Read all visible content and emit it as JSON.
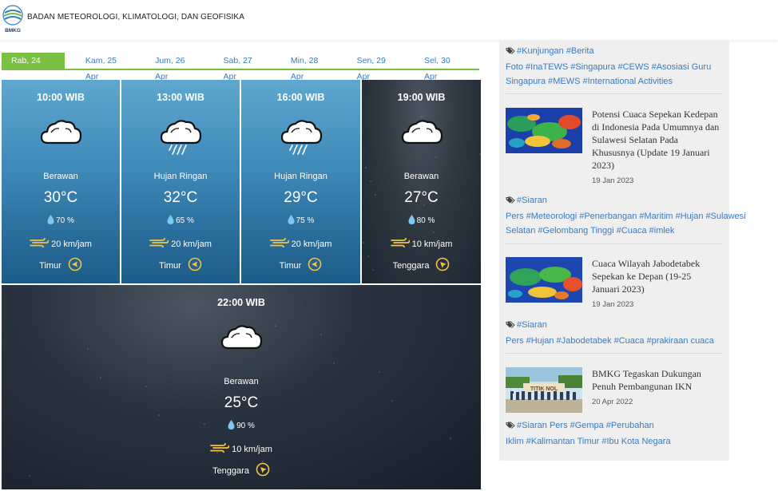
{
  "header": {
    "org_name": "BADAN METEOROLOGI, KLIMATOLOGI, DAN GEOFISIKA",
    "logo_text": "BMKG"
  },
  "tabs": [
    {
      "label": "Rab, 24 Apr",
      "active": true
    },
    {
      "label": "Kam, 25 Apr",
      "active": false
    },
    {
      "label": "Jum, 26 Apr",
      "active": false
    },
    {
      "label": "Sab, 27 Apr",
      "active": false
    },
    {
      "label": "Min, 28 Apr",
      "active": false
    },
    {
      "label": "Sen, 29 Apr",
      "active": false
    },
    {
      "label": "Sel, 30 Apr",
      "active": false
    }
  ],
  "forecasts": [
    {
      "time": "10:00 WIB",
      "icon": "cloudy-icon",
      "desc": "Berawan",
      "temp": "30°C",
      "humidity": "70 %",
      "wind": "20 km/jam",
      "direction": "Timur",
      "theme": "day"
    },
    {
      "time": "13:00 WIB",
      "icon": "light-rain-icon",
      "desc": "Hujan Ringan",
      "temp": "32°C",
      "humidity": "65 %",
      "wind": "20 km/jam",
      "direction": "Timur",
      "theme": "day"
    },
    {
      "time": "16:00 WIB",
      "icon": "light-rain-icon",
      "desc": "Hujan Ringan",
      "temp": "29°C",
      "humidity": "75 %",
      "wind": "20 km/jam",
      "direction": "Timur",
      "theme": "day"
    },
    {
      "time": "19:00 WIB",
      "icon": "cloudy-icon",
      "desc": "Berawan",
      "temp": "27°C",
      "humidity": "80 %",
      "wind": "10 km/jam",
      "direction": "Tenggara",
      "theme": "night"
    },
    {
      "time": "22:00 WIB",
      "icon": "cloudy-icon",
      "desc": "Berawan",
      "temp": "25°C",
      "humidity": "90 %",
      "wind": "10 km/jam",
      "direction": "Tenggara",
      "theme": "night"
    }
  ],
  "sidebar": {
    "top_tags": [
      "#Kunjungan",
      "#Berita Foto",
      "#InaTEWS",
      "#Singapura",
      "#CEWS",
      "#Asosiasi Guru Singapura",
      "#MEWS",
      "#International Activities"
    ],
    "news": [
      {
        "title": "Potensi Cuaca Sepekan Kedepan di Indonesia Pada Umumnya dan Sulawesi Selatan Pada Khususnya (Update 19 Januari 2023)",
        "date": "19 Jan 2023",
        "image": "weather-map-thumbnail",
        "tags": [
          "#Siaran Pers",
          "#Meteorologi",
          "#Penerbangan",
          "#Maritim",
          "#Hujan",
          "#Sulawesi Selatan",
          "#Gelombang Tinggi",
          "#Cuaca",
          "#imlek"
        ]
      },
      {
        "title": "Cuaca Wilayah Jabodetabek Sepekan ke Depan (19-25 Januari 2023)",
        "date": "19 Jan 2023",
        "image": "weather-map-thumbnail",
        "tags": [
          "#Siaran Pers",
          "#Hujan",
          "#Jabodetabek",
          "#Cuaca",
          "#prakiraan cuaca"
        ]
      },
      {
        "title": "BMKG Tegaskan Dukungan Penuh Pembangunan IKN",
        "date": "20 Apr 2022",
        "image": "group-photo-thumbnail",
        "image_text": "TITIK NOL",
        "tags": [
          "#Siaran Pers",
          "#Gempa",
          "#Perubahan Iklim",
          "#Kalimantan Timur",
          "#Ibu Kota Negara"
        ]
      }
    ]
  },
  "colors": {
    "accent_green": "#7ac143",
    "link_blue": "#3a7bbf",
    "wind_yellow": "#f5c242"
  }
}
